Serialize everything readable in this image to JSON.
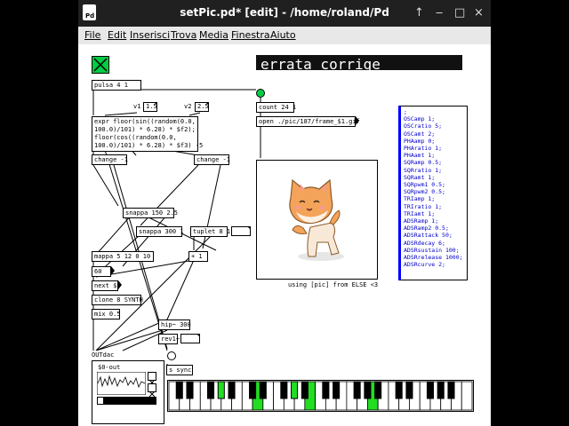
{
  "window": {
    "title": "setPic.pd* [edit] - /home/roland/Pd",
    "icon_text": "Pd",
    "controls": [
      "↑",
      "‒",
      "□",
      "×"
    ]
  },
  "menu": [
    "File",
    "Edit",
    "Inserisci",
    "Trova",
    "Media",
    "Finestra",
    "Aiuto"
  ],
  "patch": {
    "banner": "errata_corrige",
    "pulsa": "pulsa 4 1",
    "v1_label": "v1",
    "v1_value": "1.5",
    "v2_label": "v2",
    "v2_value": "2.5",
    "count": "count 24 1",
    "open_msg": "open ./pic/187/frame_$1.gif",
    "expr": "expr floor(sin((random(0.0,\n100.0)/101) * 6.28) * $f2);\nfloor(cos((random(0.0,\n100.0)/101) * 6.28) * $f3) -5",
    "change_a": "change -1",
    "change_b": "change -1",
    "snappa_a": "snappa 150 2.5",
    "snappa_b": "snappa 300 1",
    "tuplet": "tuplet 8 1",
    "mappa": "mappa 5 12 0 10",
    "n60": "60",
    "next": "next $1",
    "clone": "clone 8 SYNTH",
    "mix": "mix 0.5",
    "plus1": "+ 1",
    "hip": "hip~ 300",
    "rev": "rev1~ 30",
    "outdac": "OUTdac",
    "sync": "s sync",
    "s0out": "$0-out",
    "pic_caption": "using [pic] from ELSE <3",
    "params": [
      ";",
      "OSCamp 1;",
      "OSCratio 5;",
      "OSCamt 2;",
      "PHAamp 0;",
      "PHAratio 1;",
      "PHAamt 1;",
      "SQRamp 0.5;",
      "SQRratio 1;",
      "SQRamt 1;",
      "SQRpwm1 0.5;",
      "SQRpwm2 0.5;",
      "TRIamp 1;",
      "TRIratio 1;",
      "TRIamt 1;",
      "ADSRamp 1;",
      "ADSRamp2 0.5;",
      "ADSRattack 50;",
      "ADSRdecay 6;",
      "ADSRsustain 100;",
      "ADSRrelease 1000;",
      "ADSRcurve 2;"
    ],
    "keyboard": {
      "white_keys": 29,
      "active_white": [
        8,
        13,
        19
      ],
      "active_black": [
        3,
        8
      ]
    },
    "colors": {
      "toggle_bg": "#00cc44",
      "key_on": "#22dd22",
      "list_text": "#0000cc",
      "banner_bg": "#111111"
    }
  }
}
